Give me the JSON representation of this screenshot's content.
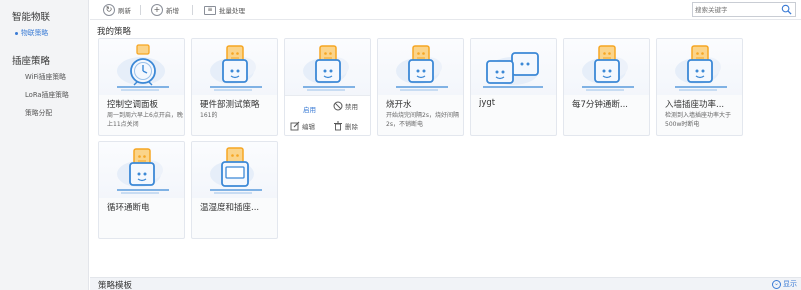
{
  "sidebar": {
    "groups": [
      {
        "title": "智能物联",
        "items": [
          {
            "label": "物联策略",
            "active": true
          }
        ]
      },
      {
        "title": "插座策略",
        "items": [
          {
            "label": "WiFi插座策略"
          },
          {
            "label": "LoRa插座策略"
          },
          {
            "label": "策略分配"
          }
        ]
      }
    ]
  },
  "toolbar": {
    "refresh_label": "刷新",
    "add_label": "新增",
    "batch_label": "批量处理",
    "search_placeholder": "搜索关键字"
  },
  "main": {
    "section_title": "我的策略",
    "cards": [
      {
        "name": "控制空调面板",
        "desc": "周一到周六早上6点开启，晚上11点关闭",
        "icon": "ac-clock-plug-icon"
      },
      {
        "name": "硬件部测试策略",
        "desc": "161的",
        "icon": "socket-plug-icon"
      },
      {
        "name": "",
        "desc": "",
        "icon": "socket-plug-icon",
        "hover": true,
        "actions": {
          "enable": "启用",
          "disable": "禁用",
          "edit": "编辑",
          "delete": "删除"
        }
      },
      {
        "name": "烧开水",
        "desc": "开始烧完间隔2s，烧好间隔2s，不销断电",
        "icon": "socket-plug-icon"
      },
      {
        "name": "jygt",
        "desc": "",
        "icon": "dual-socket-icon"
      },
      {
        "name": "每7分钟通断...",
        "desc": "",
        "icon": "socket-plug-icon"
      },
      {
        "name": "入墙插座功率...",
        "desc": "检测到入墙插座功率大于500w时断电",
        "icon": "socket-plug-icon"
      },
      {
        "name": "循环通断电",
        "desc": "",
        "icon": "socket-plug-icon"
      },
      {
        "name": "温湿度和插座...",
        "desc": "",
        "icon": "thermo-plug-icon"
      }
    ]
  },
  "templates": {
    "title": "策略模板",
    "show_label": "显示"
  },
  "colors": {
    "accent": "#3a7bd5",
    "plug_orange": "#f6a623",
    "socket_blue": "#3b88d6"
  }
}
